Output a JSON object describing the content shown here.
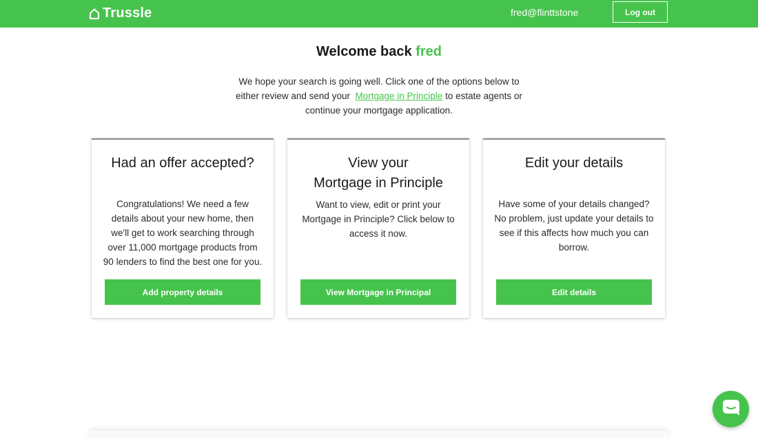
{
  "header": {
    "logo_text": "Trussle",
    "user_email": "fred@flinttstone",
    "logout_label": "Log out"
  },
  "welcome": {
    "prefix": "Welcome back",
    "name": "fred"
  },
  "intro": {
    "text_before": "We hope your search is going well. Click one of the options below to either review and send your",
    "link_text": "Mortgage in Principle",
    "text_after": "to estate agents or continue your mortgage application."
  },
  "cards": [
    {
      "title": "Had an offer accepted?",
      "body": "Congratulations! We need a few details about your new home, then we'll get to work searching through over 11,000 mortgage products from 90 lenders to find the best one for you.",
      "button": "Add property details"
    },
    {
      "title_line1": "View your",
      "title_line2": "Mortgage in Principle",
      "body": "Want to view, edit or print your Mortgage in Principle? Click below to access it now.",
      "button": "View Mortgage in Principal"
    },
    {
      "title": "Edit your details",
      "body": "Have some of your details changed? No problem, just update your details to see if this affects how much you can borrow.",
      "button": "Edit details"
    }
  ],
  "colors": {
    "brand_green": "#46c34c",
    "card_top_border": "#8a8a8a"
  },
  "icons": {
    "logo": "house-outline-icon",
    "chat": "chat-bubble-icon"
  }
}
